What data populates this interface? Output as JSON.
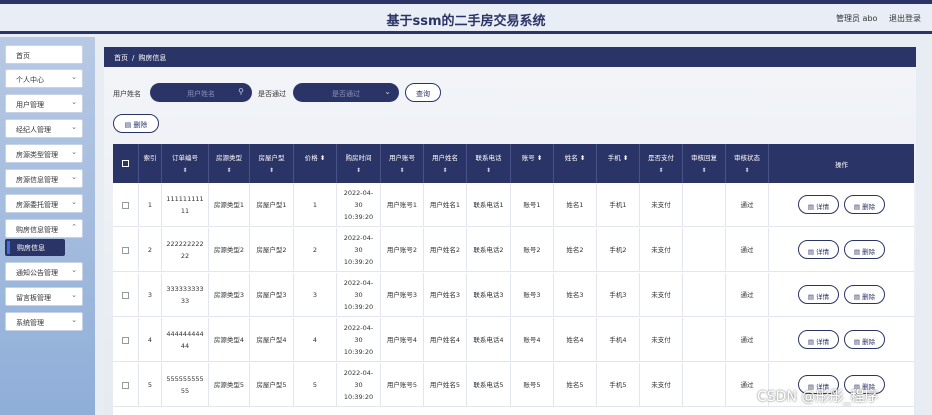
{
  "header": {
    "title": "基于ssm的二手房交易系统",
    "admin": "管理员 abo",
    "logout": "退出登录"
  },
  "sidebar": {
    "items": [
      {
        "label": "首页",
        "chev": ""
      },
      {
        "label": "个人中心",
        "chev": "⌄"
      },
      {
        "label": "用户管理",
        "chev": "⌄"
      },
      {
        "label": "经纪人管理",
        "chev": "⌄"
      },
      {
        "label": "房源类型管理",
        "chev": "⌄"
      },
      {
        "label": "房源信息管理",
        "chev": "⌄"
      },
      {
        "label": "房源委托管理",
        "chev": "⌄"
      },
      {
        "label": "购房信息管理",
        "chev": "⌃"
      },
      {
        "label": "通知公告管理",
        "chev": "⌄"
      },
      {
        "label": "留言板管理",
        "chev": "⌄"
      },
      {
        "label": "系统管理",
        "chev": "⌄"
      }
    ],
    "active_sub": "购房信息"
  },
  "breadcrumb": {
    "home": "首页",
    "sep": "/",
    "current": "购房信息"
  },
  "search": {
    "username_label": "用户姓名",
    "username_placeholder": "用户姓名",
    "approved_label": "是否通过",
    "approved_placeholder": "是否通过",
    "query_button": "查询",
    "delete_button": "删除"
  },
  "table": {
    "headers": [
      "索引",
      "订单编号",
      "房源类型",
      "房屋户型",
      "价格",
      "购房时间",
      "用户账号",
      "用户姓名",
      "联系电话",
      "账号",
      "姓名",
      "手机",
      "是否支付",
      "审核回复",
      "审核状态",
      "操作"
    ],
    "sort_glyph": "⬍",
    "detail_label": "详情",
    "delete_label": "删除",
    "rows": [
      {
        "idx": "1",
        "order": "111111111 11",
        "type": "房源类型1",
        "layout": "房屋户型1",
        "price": "1",
        "time": "2022-04-30 10:39:20",
        "uacct": "用户账号1",
        "uname": "用户姓名1",
        "phone": "联系电话1",
        "acct": "账号1",
        "name": "姓名1",
        "mobile": "手机1",
        "paid": "未支付",
        "reply": "",
        "status": "通过"
      },
      {
        "idx": "2",
        "order": "222222222 22",
        "type": "房源类型2",
        "layout": "房屋户型2",
        "price": "2",
        "time": "2022-04-30 10:39:20",
        "uacct": "用户账号2",
        "uname": "用户姓名2",
        "phone": "联系电话2",
        "acct": "账号2",
        "name": "姓名2",
        "mobile": "手机2",
        "paid": "未支付",
        "reply": "",
        "status": "通过"
      },
      {
        "idx": "3",
        "order": "333333333 33",
        "type": "房源类型3",
        "layout": "房屋户型3",
        "price": "3",
        "time": "2022-04-30 10:39:20",
        "uacct": "用户账号3",
        "uname": "用户姓名3",
        "phone": "联系电话3",
        "acct": "账号3",
        "name": "姓名3",
        "mobile": "手机3",
        "paid": "未支付",
        "reply": "",
        "status": "通过"
      },
      {
        "idx": "4",
        "order": "444444444 44",
        "type": "房源类型4",
        "layout": "房屋户型4",
        "price": "4",
        "time": "2022-04-30 10:39:20",
        "uacct": "用户账号4",
        "uname": "用户姓名4",
        "phone": "联系电话4",
        "acct": "账号4",
        "name": "姓名4",
        "mobile": "手机4",
        "paid": "未支付",
        "reply": "",
        "status": "通过"
      },
      {
        "idx": "5",
        "order": "555555555 55",
        "type": "房源类型5",
        "layout": "房屋户型5",
        "price": "5",
        "time": "2022-04-30 10:39:20",
        "uacct": "用户账号5",
        "uname": "用户姓名5",
        "phone": "联系电话5",
        "acct": "账号5",
        "name": "姓名5",
        "mobile": "手机5",
        "paid": "未支付",
        "reply": "",
        "status": "通过"
      }
    ]
  },
  "watermark": "CSDN @彤彤_程序",
  "colors": {
    "primary": "#2b3466",
    "sidebar_top": "#b7c9e4",
    "sidebar_bottom": "#8faed8"
  }
}
